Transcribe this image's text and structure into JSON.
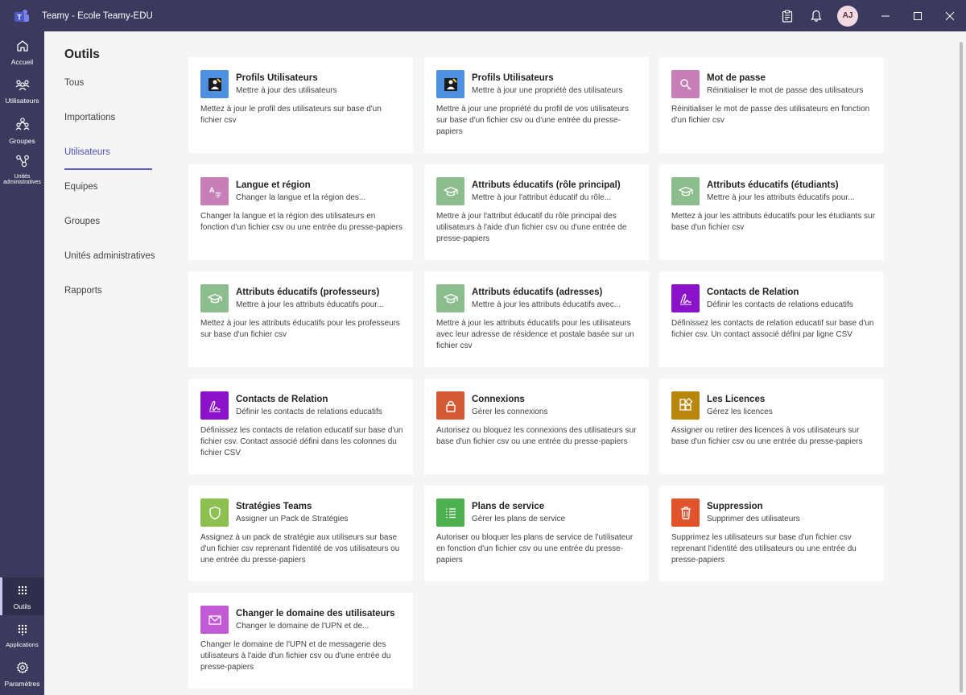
{
  "window": {
    "title": "Teamy - Ecole Teamy-EDU",
    "avatar_initials": "AJ"
  },
  "rail": {
    "items": [
      {
        "label": "Accueil",
        "icon": "home-icon"
      },
      {
        "label": "Utilisateurs",
        "icon": "users-icon"
      },
      {
        "label": "Groupes",
        "icon": "groups-icon"
      },
      {
        "label": "Unités administratives",
        "icon": "admin-units-icon"
      },
      {
        "label": "Outils",
        "icon": "grid-icon"
      },
      {
        "label": "Applications",
        "icon": "apps-icon"
      },
      {
        "label": "Paramètres",
        "icon": "gear-icon"
      }
    ],
    "active": "Outils"
  },
  "subnav": {
    "title": "Outils",
    "items": [
      "Tous",
      "Importations",
      "Utilisateurs",
      "Equipes",
      "Groupes",
      "Unités administratives",
      "Rapports"
    ],
    "active": "Utilisateurs"
  },
  "colors": {
    "accent": "#5b5fc7",
    "rail": "#3b3a5e"
  },
  "cards": [
    {
      "title": "Profils Utilisateurs",
      "subtitle": "Mettre à jour des utilisateurs",
      "description": "Mettez à jour le profil des utilisateurs sur base d'un fichier csv",
      "icon": "profile-update-icon",
      "color": "#4f8fe0"
    },
    {
      "title": "Profils Utilisateurs",
      "subtitle": "Mettre à jour une propriété des utilisateurs",
      "description": "Mettre à jour une propriété du profil de vos utilisateurs sur base d'un fichier csv ou d'une entrée du presse-papiers",
      "icon": "profile-update-icon",
      "color": "#4f8fe0"
    },
    {
      "title": "Mot de passe",
      "subtitle": "Réinitialiser le mot de passe des utilisateurs",
      "description": "Réinitialiser le mot de passe des utilisateurs en fonction d'un fichier csv",
      "icon": "key-icon",
      "color": "#c77fb8"
    },
    {
      "title": "Langue et région",
      "subtitle": "Changer la langue et la région des...",
      "description": "Changer la langue et la région des utilisateurs en fonction d'un fichier csv ou une entrée du presse-papiers",
      "icon": "language-icon",
      "color": "#c77fb8"
    },
    {
      "title": "Attributs éducatifs (rôle principal)",
      "subtitle": "Mettre à jour l'attribut éducatif du rôle...",
      "description": "Mettre à jour l'attribut éducatif du rôle principal des utilisateurs à l'aide d'un fichier csv ou d'une entrée de presse-papiers",
      "icon": "graduation-cap-icon",
      "color": "#8cbd8c"
    },
    {
      "title": "Attributs éducatifs (étudiants)",
      "subtitle": "Mettre à jour les attributs éducatifs pour...",
      "description": "Mettez à jour les attributs éducatifs pour les étudiants sur base d'un fichier csv",
      "icon": "graduation-cap-icon",
      "color": "#8cbd8c"
    },
    {
      "title": "Attributs éducatifs (professeurs)",
      "subtitle": "Mettre à jour les attributs éducatifs pour...",
      "description": "Mettez à jour les attributs éducatifs pour les professeurs sur base d'un fichier csv",
      "icon": "graduation-cap-icon",
      "color": "#8cbd8c"
    },
    {
      "title": "Attributs éducatifs (adresses)",
      "subtitle": "Mettre à jour les attributs éducatifs avec...",
      "description": "Mettre à jour les attributs éducatifs pour les utilisateurs avec leur adresse de résidence et postale basée sur un fichier csv",
      "icon": "graduation-cap-icon",
      "color": "#8cbd8c"
    },
    {
      "title": "Contacts de Relation",
      "subtitle": "Définir les contacts de relations educatifs",
      "description": "Définissez les contacts de relation educatif sur base d'un fichier csv. Un contact associé défini par ligne CSV",
      "icon": "signature-icon",
      "color": "#8a12c9"
    },
    {
      "title": "Contacts de Relation",
      "subtitle": "Définir les contacts de relations educatifs",
      "description": "Définissez les contacts de relation educatif sur base d'un fichier csv. Contact associé défini dans les colonnes du fichier CSV",
      "icon": "signature-icon",
      "color": "#8a12c9"
    },
    {
      "title": "Connexions",
      "subtitle": "Gérer les connexions",
      "description": "Autorisez ou bloquez les connexions des utilisateurs sur base d'un fichier csv ou une entrée du presse-papiers",
      "icon": "lock-icon",
      "color": "#d35a35"
    },
    {
      "title": "Les Licences",
      "subtitle": "Gérez les licences",
      "description": "Assigner ou retirer des licences à vos utilisateurs sur base d'un fichier csv ou une entrée du presse-papiers",
      "icon": "license-icon",
      "color": "#b8860b"
    },
    {
      "title": "Stratégies Teams",
      "subtitle": "Assigner un Pack de Stratégies",
      "description": "Assignez à un pack de stratégie aux utiliseurs sur base d'un fichier csv reprenant l'identité de vos utilisateurs ou une entrée du presse-papiers",
      "icon": "shield-icon",
      "color": "#8cc152"
    },
    {
      "title": "Plans de service",
      "subtitle": "Gérer les plans de service",
      "description": "Autoriser ou bloquer les plans de service de l'utilisateur en fonction d'un fichier csv ou une entrée du presse-papiers",
      "icon": "list-icon",
      "color": "#4caf50"
    },
    {
      "title": "Suppression",
      "subtitle": "Supprimer des utilisateurs",
      "description": "Supprimez les utilisateurs sur base d'un fichier csv reprenant l'identité des utilisateurs ou une entrée du presse-papiers",
      "icon": "trash-icon",
      "color": "#e0532b"
    },
    {
      "title": "Changer le domaine des utilisateurs",
      "subtitle": "Changer le domaine de l'UPN et de...",
      "description": "Changer le domaine de l'UPN et de messagerie des utilisateurs à l'aide d'un fichier csv ou d'une entrée du presse-papiers",
      "icon": "mail-icon",
      "color": "#c25ad6"
    }
  ]
}
